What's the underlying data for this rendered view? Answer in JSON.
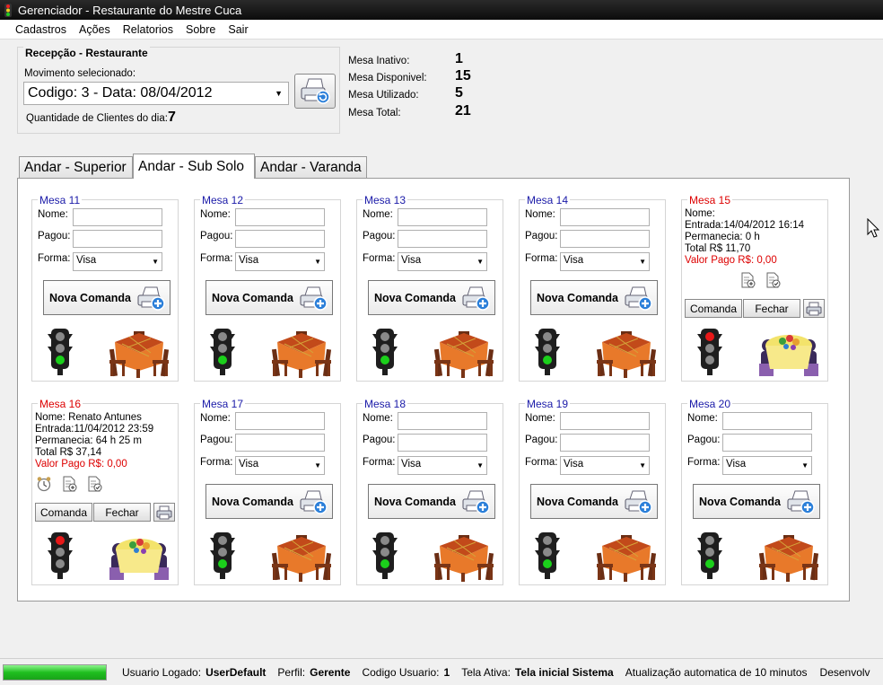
{
  "window": {
    "title": "Gerenciador - Restaurante do Mestre Cuca"
  },
  "menu": [
    "Cadastros",
    "Ações",
    "Relatorios",
    "Sobre",
    "Sair"
  ],
  "recepcao": {
    "title": "Recepção - Restaurante",
    "movimento_label": "Movimento selecionado:",
    "movimento_value": "Codigo: 3 - Data: 08/04/2012",
    "qtd_label": "Quantidade de Clientes do dia:",
    "qtd_value": "7"
  },
  "stats": [
    {
      "label": "Mesa Inativo:",
      "value": "1"
    },
    {
      "label": "Mesa Disponivel:",
      "value": "15"
    },
    {
      "label": "Mesa Utilizado:",
      "value": "5"
    },
    {
      "label": "Mesa Total:",
      "value": "21"
    }
  ],
  "tabs": [
    "Andar - Superior",
    "Andar - Sub Solo",
    "Andar - Varanda"
  ],
  "active_tab": 1,
  "labels": {
    "nome": "Nome:",
    "pagou": "Pagou:",
    "forma": "Forma:",
    "forma_default": "Visa",
    "nova_comanda": "Nova Comanda",
    "comanda": "Comanda",
    "fechar": "Fechar"
  },
  "mesas": [
    {
      "title": "Mesa 11",
      "status": "free"
    },
    {
      "title": "Mesa 12",
      "status": "free"
    },
    {
      "title": "Mesa 13",
      "status": "free"
    },
    {
      "title": "Mesa 14",
      "status": "free"
    },
    {
      "title": "Mesa 15",
      "status": "busy",
      "nome": "Nome:",
      "entrada": "Entrada:14/04/2012 16:14",
      "permanencia": "Permanecia: 0 h",
      "total": "Total R$ 11,70",
      "valor_pago": "Valor Pago R$: 0,00"
    },
    {
      "title": "Mesa 16",
      "status": "busy",
      "nome": "Nome: Renato Antunes",
      "entrada": "Entrada:11/04/2012 23:59",
      "permanencia": "Permanecia: 64 h 25 m",
      "total": "Total R$ 37,14",
      "valor_pago": "Valor Pago R$: 0,00",
      "alarm": true
    },
    {
      "title": "Mesa 17",
      "status": "free"
    },
    {
      "title": "Mesa 18",
      "status": "free"
    },
    {
      "title": "Mesa 19",
      "status": "free"
    },
    {
      "title": "Mesa 20",
      "status": "free"
    }
  ],
  "status": {
    "usuario_label": "Usuario Logado:",
    "usuario": "UserDefault",
    "perfil_label": "Perfil:",
    "perfil": "Gerente",
    "codigo_label": "Codigo Usuario:",
    "codigo": "1",
    "tela_label": "Tela Ativa:",
    "tela": "Tela inicial Sistema",
    "auto": "Atualização automatica de 10 minutos",
    "dev": "Desenvolv"
  },
  "colors": {
    "free_title": "#1a1aa8",
    "busy_title": "#dd0000",
    "progress": "#1fbf1f"
  }
}
